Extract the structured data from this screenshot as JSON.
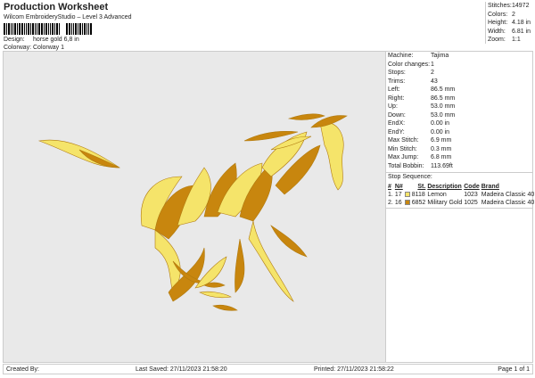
{
  "header": {
    "title": "Production Worksheet",
    "subtitle": "Wilcom EmbroideryStudio – Level 3 Advanced",
    "design_label": "Design:",
    "design_value": "horse gold 6,8 in",
    "colorway_label": "Colorway:",
    "colorway_value": "Colorway 1"
  },
  "stats": [
    {
      "k": "Stitches:",
      "v": "14972"
    },
    {
      "k": "Colors:",
      "v": "2"
    },
    {
      "k": "Height:",
      "v": "4.18 in"
    },
    {
      "k": "Width:",
      "v": "6.81 in"
    },
    {
      "k": "Zoom:",
      "v": "1:1"
    }
  ],
  "info": [
    {
      "k": "Machine:",
      "v": "Tajima"
    },
    {
      "k": "Color changes:",
      "v": "1"
    },
    {
      "k": "Stops:",
      "v": "2"
    },
    {
      "k": "Trims:",
      "v": "43"
    },
    {
      "k": "Left:",
      "v": "86.5 mm"
    },
    {
      "k": "Right:",
      "v": "86.5 mm"
    },
    {
      "k": "Up:",
      "v": "53.0 mm"
    },
    {
      "k": "Down:",
      "v": "53.0 mm"
    },
    {
      "k": "EndX:",
      "v": "0.00 in"
    },
    {
      "k": "EndY:",
      "v": "0.00 in"
    },
    {
      "k": "Max Stitch:",
      "v": "6.9 mm"
    },
    {
      "k": "Min Stitch:",
      "v": "0.3 mm"
    },
    {
      "k": "Max Jump:",
      "v": "6.8 mm"
    },
    {
      "k": "Total Bobbin:",
      "v": "113.69ft"
    }
  ],
  "stop_sequence": {
    "title": "Stop Sequence:",
    "headers": [
      "#",
      "N#",
      "St.",
      "Description",
      "Code",
      "Brand"
    ],
    "rows": [
      {
        "n": "1.",
        "needle": "17",
        "color": "#f5e46a",
        "st": "8118",
        "desc": "Lemon",
        "code": "1023",
        "brand": "Madeira Classic 40"
      },
      {
        "n": "2.",
        "needle": "16",
        "color": "#c8860e",
        "st": "6852",
        "desc": "Military Gold",
        "code": "1025",
        "brand": "Madeira Classic 40"
      }
    ]
  },
  "footer": {
    "created": "Created By:",
    "saved": "Last Saved: 27/11/2023 21:58:20",
    "printed": "Printed: 27/11/2023 21:58:22",
    "page": "Page 1 of 1"
  }
}
